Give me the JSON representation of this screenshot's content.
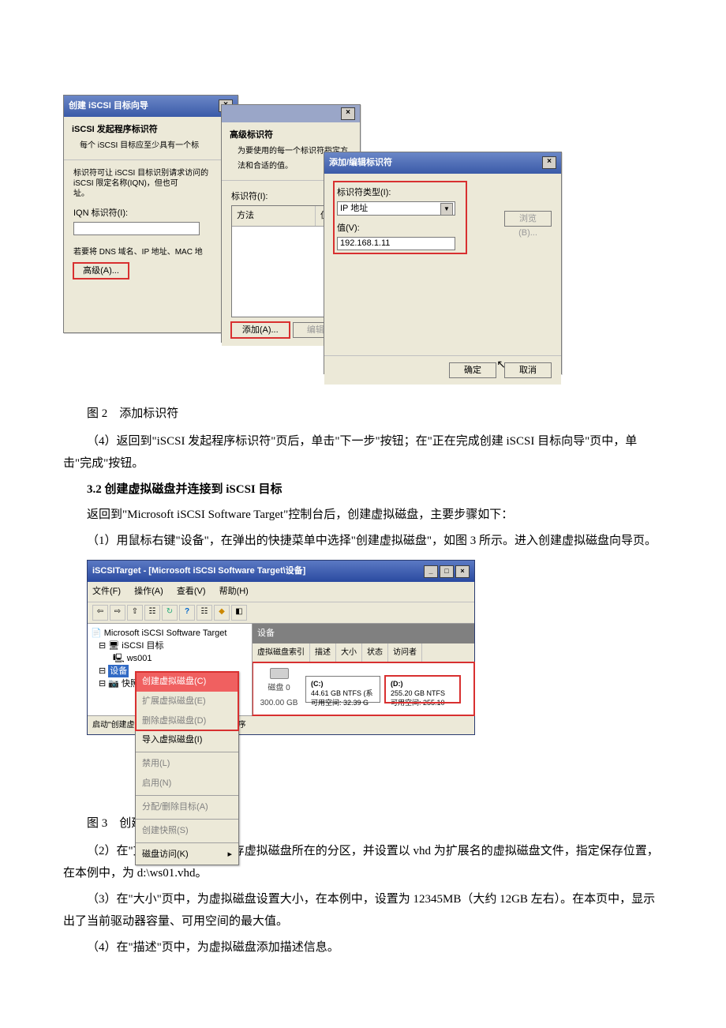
{
  "fig1": {
    "d1": {
      "title": "创建 iSCSI 目标向导",
      "sub_h1": "iSCSI 发起程序标识符",
      "sub_h2": "每个 iSCSI 目标应至少具有一个标",
      "body_line1": "标识符可让 iSCSI 目标识别请求访问的 iSCSI 限定名称(IQN)，但也可",
      "body_line2": "址。",
      "iqn_label": "IQN 标识符(I):",
      "dns_line": "若要将 DNS 域名、IP 地址、MAC 地",
      "adv_btn": "高级(A)..."
    },
    "d2": {
      "sub_h1": "高级标识符",
      "sub_h2": "为要使用的每一个标识符指定方法和合适的值。",
      "list_label": "标识符(I):",
      "col1": "方法",
      "col2": "值",
      "add_btn": "添加(A)...",
      "edit_btn": "编辑(E)"
    },
    "d3": {
      "title": "添加/编辑标识符",
      "type_label": "标识符类型(I):",
      "type_value": "IP 地址",
      "val_label": "值(V):",
      "val_value": "192.168.1.11",
      "browse_btn": "浏览(B)...",
      "ok_btn": "确定",
      "cancel_btn": "取消"
    }
  },
  "cap1": "图 2　添加标识符",
  "p1": "（4）返回到\"iSCSI 发起程序标识符\"页后，单击\"下一步\"按钮；在\"正在完成创建 iSCSI 目标向导\"页中，单击\"完成\"按钮。",
  "h32": "3.2  创建虚拟磁盘并连接到 iSCSI 目标",
  "p2": "返回到\"Microsoft iSCSI Software Target\"控制台后，创建虚拟磁盘，主要步骤如下：",
  "p3": "（1）用鼠标右键\"设备\"，在弹出的快捷菜单中选择\"创建虚拟磁盘\"，如图 3 所示。进入创建虚拟磁盘向导页。",
  "fig2": {
    "title": "iSCSITarget - [Microsoft iSCSI Software Target\\设备]",
    "menu": {
      "file": "文件(F)",
      "action": "操作(A)",
      "view": "查看(V)",
      "help": "帮助(H)"
    },
    "tree": {
      "root": "Microsoft iSCSI Software Target",
      "t1": "iSCSI 目标",
      "t1a": "ws001",
      "t2": "设备",
      "t3": "快照"
    },
    "ctx": {
      "m1": "创建虚拟磁盘(C)",
      "m2": "扩展虚拟磁盘(E)",
      "m3": "删除虚拟磁盘(D)",
      "m4": "导入虚拟磁盘(I)",
      "m5": "禁用(L)",
      "m6": "启用(N)",
      "m7": "分配/删除目标(A)",
      "m8": "创建快照(S)",
      "m9": "磁盘访问(K)"
    },
    "rpane": {
      "hd": "设备",
      "c1": "虚拟磁盘索引",
      "c2": "描述",
      "c3": "大小",
      "c4": "状态",
      "c5": "访问者"
    },
    "disk": {
      "name": "磁盘 0",
      "size": "300.00 GB",
      "c_label": "(C:)",
      "c_line1": "44.61 GB NTFS (系",
      "c_line2": "可用空间: 32.39 G",
      "d_label": "(D:)",
      "d_line1": "255.20 GB NTFS",
      "d_line2": "可用空间: 255.10"
    },
    "status_left": "启动\"创建虚",
    "status_right": "让您创建由 iSCSI 发起程序"
  },
  "cap2": "图 3　创建虚拟磁盘",
  "p4": "（2）在\"文件\"页中，选择保存虚拟磁盘所在的分区，并设置以 vhd 为扩展名的虚拟磁盘文件，指定保存位置，在本例中，为 d:\\ws01.vhd。",
  "p5": "（3）在\"大小\"页中，为虚拟磁盘设置大小，在本例中，设置为 12345MB（大约 12GB 左右）。在本页中，显示出了当前驱动器容量、可用空间的最大值。",
  "p6": "（4）在\"描述\"页中，为虚拟磁盘添加描述信息。"
}
